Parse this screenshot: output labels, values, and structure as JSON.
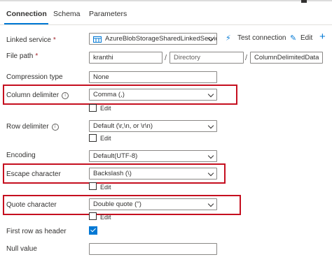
{
  "tabs": [
    {
      "label": "Connection"
    },
    {
      "label": "Schema"
    },
    {
      "label": "Parameters"
    }
  ],
  "linked_service": {
    "label": "Linked service",
    "required_mark": "*",
    "value": "AzureBlobStorageSharedLinkedService",
    "test_connection_label": "Test connection",
    "edit_label": "Edit",
    "add_label": "+"
  },
  "file_path": {
    "label": "File path",
    "required_mark": "*",
    "container": "kranthi",
    "directory_placeholder": "Directory",
    "file_value": "ColumnDelimitedData",
    "separator": "/"
  },
  "compression_type": {
    "label": "Compression type",
    "value": "None"
  },
  "column_delimiter": {
    "label": "Column delimiter",
    "info": "i",
    "value": "Comma (,)",
    "edit_label": "Edit"
  },
  "row_delimiter": {
    "label": "Row delimiter",
    "info": "i",
    "value": "Default (\\r,\\n, or \\r\\n)",
    "edit_label": "Edit"
  },
  "encoding": {
    "label": "Encoding",
    "value": "Default(UTF-8)"
  },
  "escape_character": {
    "label": "Escape character",
    "value": "Backslash (\\)",
    "edit_label": "Edit"
  },
  "quote_character": {
    "label": "Quote character",
    "value": "Double quote (\")",
    "edit_label": "Edit"
  },
  "first_row_as_header": {
    "label": "First row as header",
    "checked": true
  },
  "null_value": {
    "label": "Null value",
    "value": ""
  },
  "colors": {
    "accent": "#0078d4",
    "highlight": "#c50f1f",
    "required": "#a4262c"
  }
}
